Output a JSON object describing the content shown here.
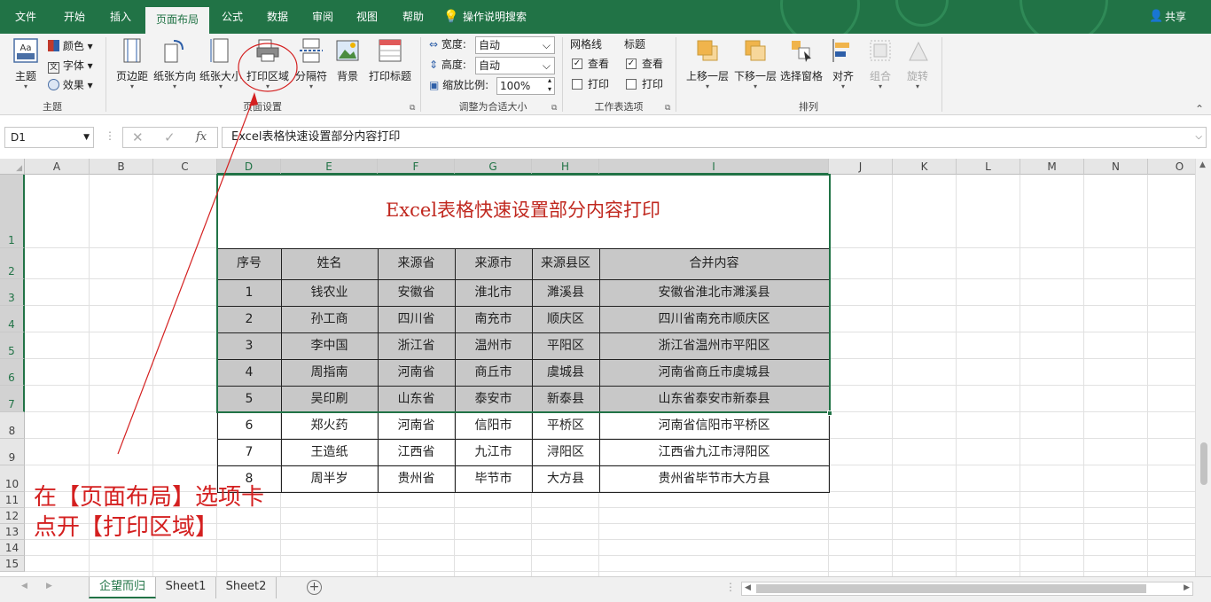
{
  "ribbon_tabs": [
    "文件",
    "开始",
    "插入",
    "页面布局",
    "公式",
    "数据",
    "审阅",
    "视图",
    "帮助",
    "操作说明搜索"
  ],
  "active_tab": "页面布局",
  "share_label": "共享",
  "groups": {
    "theme": {
      "label": "主题",
      "theme_btn": "主题",
      "colors": "颜色",
      "fonts": "字体",
      "effects": "效果"
    },
    "page_setup": {
      "label": "页面设置",
      "margins": "页边距",
      "orientation": "纸张方向",
      "size": "纸张大小",
      "print_area": "打印区域",
      "breaks": "分隔符",
      "background": "背景",
      "print_titles": "打印标题"
    },
    "scale": {
      "label": "调整为合适大小",
      "width_label": "宽度:",
      "width_value": "自动",
      "height_label": "高度:",
      "height_value": "自动",
      "scale_label": "缩放比例:",
      "scale_value": "100%"
    },
    "sheet_options": {
      "label": "工作表选项",
      "gridlines": "网格线",
      "headings": "标题",
      "view": "查看",
      "print": "打印"
    },
    "arrange": {
      "label": "排列",
      "bring_forward": "上移一层",
      "send_backward": "下移一层",
      "selection_pane": "选择窗格",
      "align": "对齐",
      "group": "组合",
      "rotate": "旋转"
    }
  },
  "formula_bar": {
    "name_box": "D1",
    "fx": "fx",
    "content": "Excel表格快速设置部分内容打印"
  },
  "columns": [
    "A",
    "B",
    "C",
    "D",
    "E",
    "F",
    "G",
    "H",
    "I",
    "J",
    "K",
    "L",
    "M",
    "N",
    "O"
  ],
  "rows": [
    "1",
    "2",
    "3",
    "4",
    "5",
    "6",
    "7",
    "8",
    "9",
    "10",
    "11",
    "12",
    "13",
    "14",
    "15"
  ],
  "table": {
    "title": "Excel表格快速设置部分内容打印",
    "headers": [
      "序号",
      "姓名",
      "来源省",
      "来源市",
      "来源县区",
      "合并内容"
    ],
    "rows": [
      [
        "1",
        "钱农业",
        "安徽省",
        "淮北市",
        "濉溪县",
        "安徽省淮北市濉溪县"
      ],
      [
        "2",
        "孙工商",
        "四川省",
        "南充市",
        "顺庆区",
        "四川省南充市顺庆区"
      ],
      [
        "3",
        "李中国",
        "浙江省",
        "温州市",
        "平阳区",
        "浙江省温州市平阳区"
      ],
      [
        "4",
        "周指南",
        "河南省",
        "商丘市",
        "虞城县",
        "河南省商丘市虞城县"
      ],
      [
        "5",
        "吴印刷",
        "山东省",
        "泰安市",
        "新泰县",
        "山东省泰安市新泰县"
      ],
      [
        "6",
        "郑火药",
        "河南省",
        "信阳市",
        "平桥区",
        "河南省信阳市平桥区"
      ],
      [
        "7",
        "王造纸",
        "江西省",
        "九江市",
        "浔阳区",
        "江西省九江市浔阳区"
      ],
      [
        "8",
        "周半岁",
        "贵州省",
        "毕节市",
        "大方县",
        "贵州省毕节市大方县"
      ]
    ]
  },
  "annotation": {
    "line1": "在【页面布局】选项卡",
    "line2": "点开【打印区域】"
  },
  "sheet_tabs": [
    "企望而归",
    "Sheet1",
    "Sheet2"
  ],
  "active_sheet": "企望而归",
  "colors": {
    "excel_green": "#217346",
    "annotation_red": "#d42020",
    "selection_fill": "#c8c8c8",
    "title_red": "#c0281f"
  }
}
